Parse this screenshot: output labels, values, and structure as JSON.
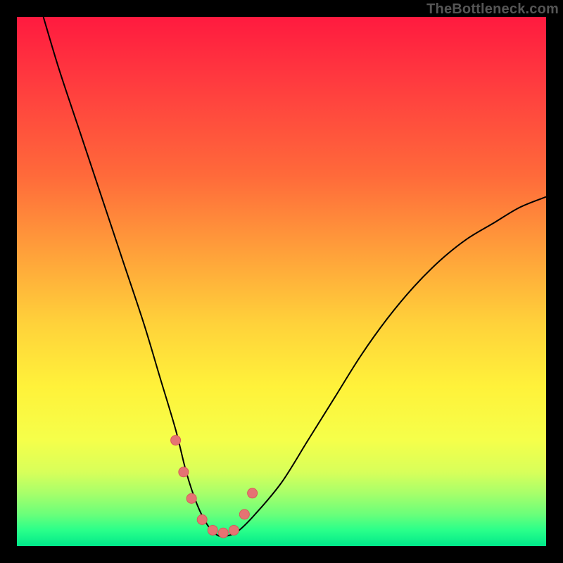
{
  "watermark": "TheBottleneck.com",
  "chart_data": {
    "type": "line",
    "title": "",
    "xlabel": "",
    "ylabel": "",
    "x_range": [
      0,
      100
    ],
    "y_range": [
      0,
      100
    ],
    "series": [
      {
        "name": "bottleneck-curve",
        "x": [
          5,
          8,
          12,
          16,
          20,
          24,
          27,
          30,
          32,
          34,
          36,
          38,
          40,
          42,
          45,
          50,
          55,
          60,
          65,
          70,
          75,
          80,
          85,
          90,
          95,
          100
        ],
        "y": [
          100,
          90,
          78,
          66,
          54,
          42,
          32,
          22,
          14,
          8,
          4,
          2,
          2,
          3,
          6,
          12,
          20,
          28,
          36,
          43,
          49,
          54,
          58,
          61,
          64,
          66
        ]
      }
    ],
    "markers": {
      "name": "highlighted-points",
      "x": [
        30,
        31.5,
        33,
        35,
        37,
        39,
        41,
        43,
        44.5
      ],
      "y": [
        20,
        14,
        9,
        5,
        3,
        2.5,
        3,
        6,
        10
      ]
    },
    "gradient_stops": [
      {
        "pos": 0.0,
        "color": "#ff1a3f"
      },
      {
        "pos": 0.3,
        "color": "#ff6a3a"
      },
      {
        "pos": 0.58,
        "color": "#ffd23a"
      },
      {
        "pos": 0.8,
        "color": "#f5ff4a"
      },
      {
        "pos": 0.94,
        "color": "#6aff7a"
      },
      {
        "pos": 1.0,
        "color": "#00e88a"
      }
    ]
  }
}
